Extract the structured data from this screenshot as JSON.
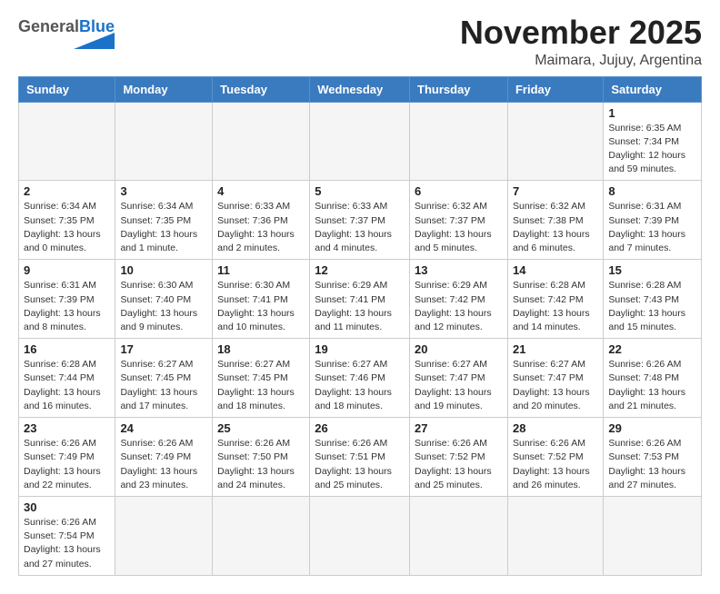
{
  "header": {
    "logo_general": "General",
    "logo_blue": "Blue",
    "month_title": "November 2025",
    "location": "Maimara, Jujuy, Argentina"
  },
  "days_of_week": [
    "Sunday",
    "Monday",
    "Tuesday",
    "Wednesday",
    "Thursday",
    "Friday",
    "Saturday"
  ],
  "weeks": [
    [
      {
        "day": "",
        "info": ""
      },
      {
        "day": "",
        "info": ""
      },
      {
        "day": "",
        "info": ""
      },
      {
        "day": "",
        "info": ""
      },
      {
        "day": "",
        "info": ""
      },
      {
        "day": "",
        "info": ""
      },
      {
        "day": "1",
        "info": "Sunrise: 6:35 AM\nSunset: 7:34 PM\nDaylight: 12 hours\nand 59 minutes."
      }
    ],
    [
      {
        "day": "2",
        "info": "Sunrise: 6:34 AM\nSunset: 7:35 PM\nDaylight: 13 hours\nand 0 minutes."
      },
      {
        "day": "3",
        "info": "Sunrise: 6:34 AM\nSunset: 7:35 PM\nDaylight: 13 hours\nand 1 minute."
      },
      {
        "day": "4",
        "info": "Sunrise: 6:33 AM\nSunset: 7:36 PM\nDaylight: 13 hours\nand 2 minutes."
      },
      {
        "day": "5",
        "info": "Sunrise: 6:33 AM\nSunset: 7:37 PM\nDaylight: 13 hours\nand 4 minutes."
      },
      {
        "day": "6",
        "info": "Sunrise: 6:32 AM\nSunset: 7:37 PM\nDaylight: 13 hours\nand 5 minutes."
      },
      {
        "day": "7",
        "info": "Sunrise: 6:32 AM\nSunset: 7:38 PM\nDaylight: 13 hours\nand 6 minutes."
      },
      {
        "day": "8",
        "info": "Sunrise: 6:31 AM\nSunset: 7:39 PM\nDaylight: 13 hours\nand 7 minutes."
      }
    ],
    [
      {
        "day": "9",
        "info": "Sunrise: 6:31 AM\nSunset: 7:39 PM\nDaylight: 13 hours\nand 8 minutes."
      },
      {
        "day": "10",
        "info": "Sunrise: 6:30 AM\nSunset: 7:40 PM\nDaylight: 13 hours\nand 9 minutes."
      },
      {
        "day": "11",
        "info": "Sunrise: 6:30 AM\nSunset: 7:41 PM\nDaylight: 13 hours\nand 10 minutes."
      },
      {
        "day": "12",
        "info": "Sunrise: 6:29 AM\nSunset: 7:41 PM\nDaylight: 13 hours\nand 11 minutes."
      },
      {
        "day": "13",
        "info": "Sunrise: 6:29 AM\nSunset: 7:42 PM\nDaylight: 13 hours\nand 12 minutes."
      },
      {
        "day": "14",
        "info": "Sunrise: 6:28 AM\nSunset: 7:42 PM\nDaylight: 13 hours\nand 14 minutes."
      },
      {
        "day": "15",
        "info": "Sunrise: 6:28 AM\nSunset: 7:43 PM\nDaylight: 13 hours\nand 15 minutes."
      }
    ],
    [
      {
        "day": "16",
        "info": "Sunrise: 6:28 AM\nSunset: 7:44 PM\nDaylight: 13 hours\nand 16 minutes."
      },
      {
        "day": "17",
        "info": "Sunrise: 6:27 AM\nSunset: 7:45 PM\nDaylight: 13 hours\nand 17 minutes."
      },
      {
        "day": "18",
        "info": "Sunrise: 6:27 AM\nSunset: 7:45 PM\nDaylight: 13 hours\nand 18 minutes."
      },
      {
        "day": "19",
        "info": "Sunrise: 6:27 AM\nSunset: 7:46 PM\nDaylight: 13 hours\nand 18 minutes."
      },
      {
        "day": "20",
        "info": "Sunrise: 6:27 AM\nSunset: 7:47 PM\nDaylight: 13 hours\nand 19 minutes."
      },
      {
        "day": "21",
        "info": "Sunrise: 6:27 AM\nSunset: 7:47 PM\nDaylight: 13 hours\nand 20 minutes."
      },
      {
        "day": "22",
        "info": "Sunrise: 6:26 AM\nSunset: 7:48 PM\nDaylight: 13 hours\nand 21 minutes."
      }
    ],
    [
      {
        "day": "23",
        "info": "Sunrise: 6:26 AM\nSunset: 7:49 PM\nDaylight: 13 hours\nand 22 minutes."
      },
      {
        "day": "24",
        "info": "Sunrise: 6:26 AM\nSunset: 7:49 PM\nDaylight: 13 hours\nand 23 minutes."
      },
      {
        "day": "25",
        "info": "Sunrise: 6:26 AM\nSunset: 7:50 PM\nDaylight: 13 hours\nand 24 minutes."
      },
      {
        "day": "26",
        "info": "Sunrise: 6:26 AM\nSunset: 7:51 PM\nDaylight: 13 hours\nand 25 minutes."
      },
      {
        "day": "27",
        "info": "Sunrise: 6:26 AM\nSunset: 7:52 PM\nDaylight: 13 hours\nand 25 minutes."
      },
      {
        "day": "28",
        "info": "Sunrise: 6:26 AM\nSunset: 7:52 PM\nDaylight: 13 hours\nand 26 minutes."
      },
      {
        "day": "29",
        "info": "Sunrise: 6:26 AM\nSunset: 7:53 PM\nDaylight: 13 hours\nand 27 minutes."
      }
    ],
    [
      {
        "day": "30",
        "info": "Sunrise: 6:26 AM\nSunset: 7:54 PM\nDaylight: 13 hours\nand 27 minutes."
      },
      {
        "day": "",
        "info": ""
      },
      {
        "day": "",
        "info": ""
      },
      {
        "day": "",
        "info": ""
      },
      {
        "day": "",
        "info": ""
      },
      {
        "day": "",
        "info": ""
      },
      {
        "day": "",
        "info": ""
      }
    ]
  ]
}
